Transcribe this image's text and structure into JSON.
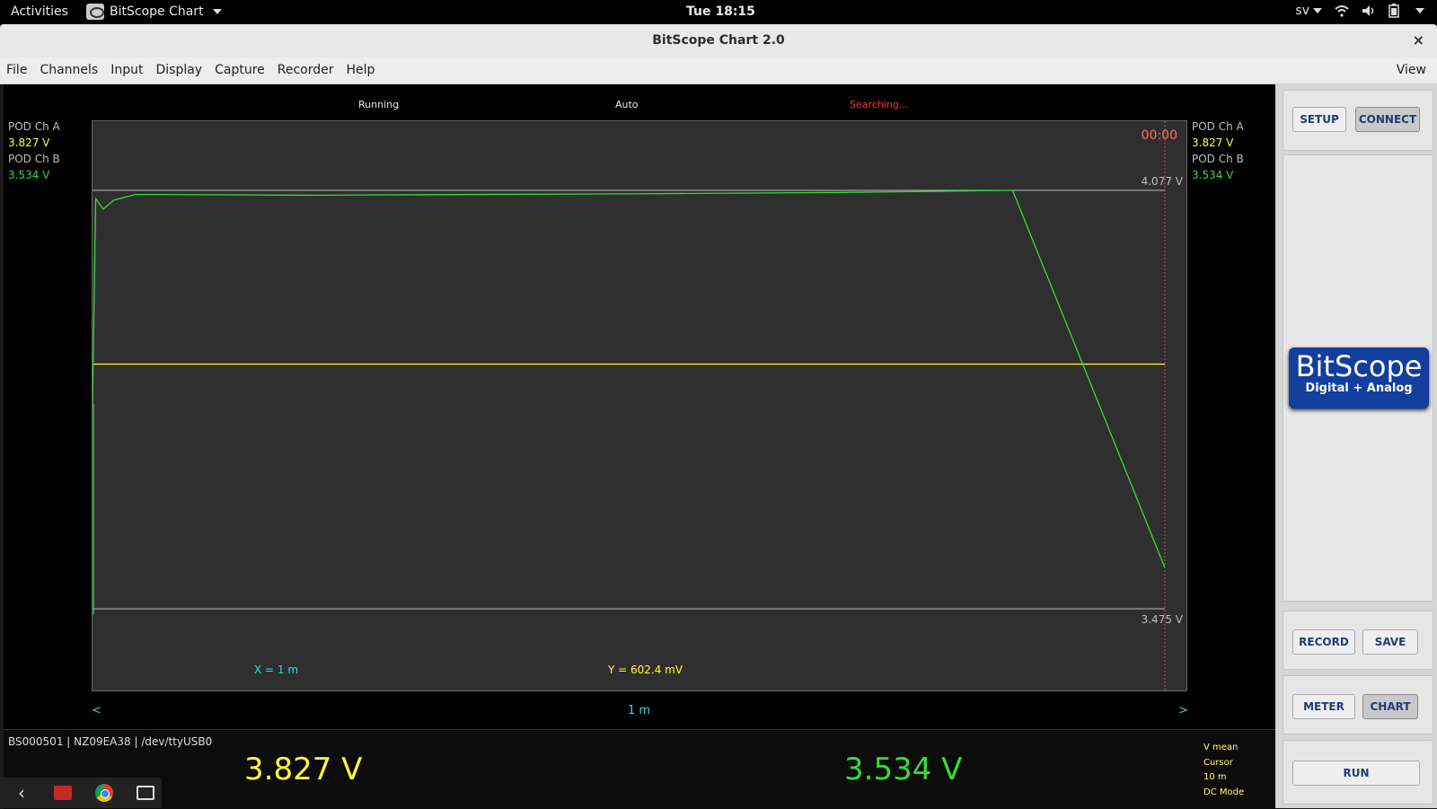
{
  "system": {
    "activities": "Activities",
    "app_name": "BitScope Chart",
    "clock": "Tue 18:15",
    "lang": "sv"
  },
  "window": {
    "title": "BitScope Chart 2.0",
    "close": "×"
  },
  "menu": {
    "items": [
      "File",
      "Channels",
      "Input",
      "Display",
      "Capture",
      "Recorder",
      "Help"
    ],
    "view": "View"
  },
  "status": {
    "running": "Running",
    "mode": "Auto",
    "searching": "Searching..."
  },
  "channels": {
    "a_label": "POD Ch A",
    "a_value": "3.827  V",
    "b_label": "POD Ch B",
    "b_value": "3.534  V"
  },
  "plot": {
    "time": "00:00",
    "upper_voltage": "4.077  V",
    "lower_voltage": "3.475  V",
    "x_cursor": "X = 1 m",
    "y_cursor": "Y = 602.4 mV",
    "timebase": "1 m",
    "nav_left": "<",
    "nav_right": ">",
    "colors": {
      "ch_a": "#ffff33",
      "ch_b": "#33dd33"
    }
  },
  "chart_data": {
    "type": "line",
    "ylim": [
      3.475,
      4.077
    ],
    "series": [
      {
        "name": "POD Ch A",
        "x": [
          0,
          1
        ],
        "values": [
          3.827,
          3.827
        ]
      },
      {
        "name": "POD Ch B",
        "x": [
          0,
          0.003,
          0.01,
          0.02,
          0.04,
          0.06,
          0.2,
          0.5,
          0.7,
          0.858,
          1.0
        ],
        "values": [
          3.77,
          4.065,
          4.05,
          4.063,
          4.071,
          4.071,
          4.07,
          4.072,
          4.074,
          4.077,
          3.534
        ]
      }
    ]
  },
  "footer": {
    "device": "BS000501 | NZ09EA38 | /dev/ttyUSB0",
    "big_a": "3.827  V",
    "big_b": "3.534  V",
    "modes": [
      "V mean",
      "Cursor",
      "10 m",
      "DC Mode"
    ]
  },
  "side": {
    "setup": "SETUP",
    "connect": "CONNECT",
    "logo_title": "BitScope",
    "logo_sub": "Digital + Analog",
    "record": "RECORD",
    "save": "SAVE",
    "meter": "METER",
    "chart": "CHART",
    "run": "RUN"
  }
}
